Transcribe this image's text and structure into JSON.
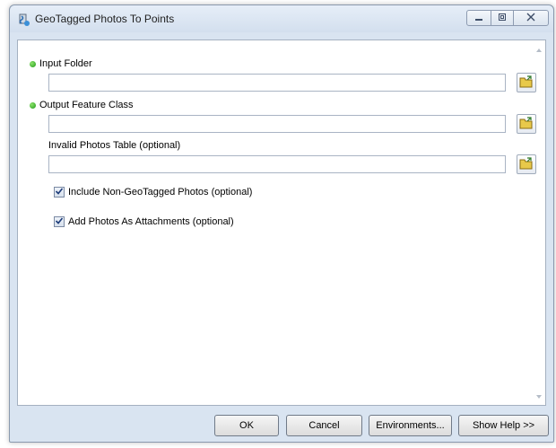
{
  "window": {
    "title": "GeoTagged Photos To Points",
    "icon": "toolbox-script-icon"
  },
  "titlebar_controls": {
    "minimize": "minimize-icon",
    "maximize": "maximize-icon",
    "close": "close-icon"
  },
  "params": {
    "input_folder": {
      "label": "Input Folder",
      "value": "",
      "required": true
    },
    "output_feature_class": {
      "label": "Output Feature Class",
      "value": "",
      "required": true
    },
    "invalid_photos_table": {
      "label": "Invalid Photos Table (optional)",
      "value": "",
      "required": false
    },
    "include_non_geotagged": {
      "label": "Include Non-GeoTagged Photos (optional)",
      "checked": true
    },
    "add_photos_as_attachments": {
      "label": "Add Photos As Attachments (optional)",
      "checked": true
    }
  },
  "footer": {
    "ok": "OK",
    "cancel": "Cancel",
    "environments": "Environments...",
    "show_help": "Show Help >>"
  },
  "colors": {
    "window_frame": "#d9e4f1",
    "required_dot": "#2fae23",
    "browse_folder": "#e8c94a"
  }
}
